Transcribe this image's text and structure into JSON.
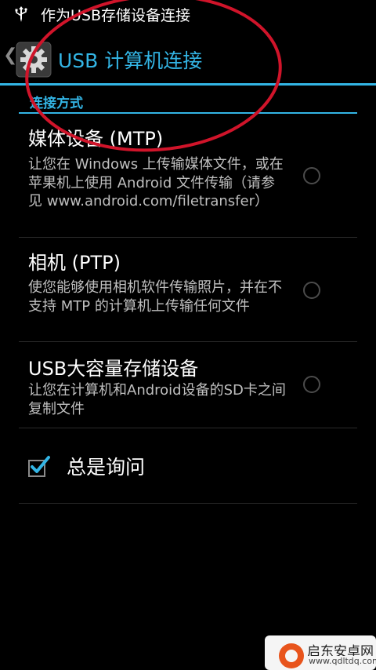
{
  "status_bar": {
    "text": "作为USB存储设备连接",
    "icon": "usb-icon"
  },
  "action_bar": {
    "title": "USB 计算机连接",
    "icon": "settings-gear-icon",
    "back_icon": "chevron-left-icon",
    "accent_color": "#33b5e5"
  },
  "section": {
    "header": "连接方式"
  },
  "options": [
    {
      "title": "媒体设备 (MTP)",
      "description": "让您在 Windows 上传输媒体文件，或在苹果机上使用 Android 文件传输（请参见 www.android.com/filetransfer）",
      "selected": false
    },
    {
      "title": "相机 (PTP)",
      "description": "使您能够使用相机软件传输照片，并在不支持 MTP 的计算机上传输任何文件",
      "selected": false
    },
    {
      "title": "USB大容量存储设备",
      "description": "让您在计算机和Android设备的SD卡之间复制文件",
      "selected": false
    }
  ],
  "always_ask": {
    "label": "总是询问",
    "checked": true
  },
  "watermark": {
    "name": "启东安卓网",
    "url": "www.qdltdq.com"
  }
}
